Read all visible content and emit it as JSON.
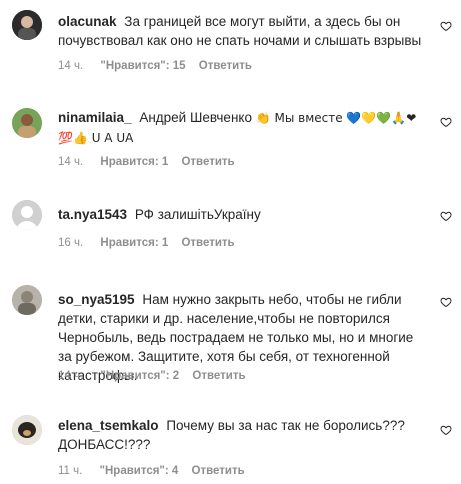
{
  "comments": [
    {
      "username": "olacunak",
      "text": "За границей все могут выйти, а здесь бы он почувствовал как оно не спать ночами и слышать взрывы",
      "time": "14 ч.",
      "likes": "\"Нравится\": 15",
      "reply": "Ответить"
    },
    {
      "username": "ninamilaia_",
      "text": "Андрей Шевченко",
      "emoji_text_1": "👏 Мы вместе 💙💛💚🙏❤",
      "emoji_text_2": "💯👍 U A UA",
      "time": "14 ч.",
      "likes": "Нравится: 1",
      "reply": "Ответить"
    },
    {
      "username": "ta.nya1543",
      "text": "РФ залишітьУкраїну",
      "time": "16 ч.",
      "likes": "Нравится: 1",
      "reply": "Ответить"
    },
    {
      "username": "so_nya5195",
      "text": "Нам нужно закрыть небо, чтобы не гибли детки, старики и др. население,чтобы не повторился Чернобыль, ведь пострадаем не только мы, но и многие за рубежом. Защитите, хотя бы себя, от техногенной катастрофы.",
      "time": "14 ч.",
      "likes": "\"Нравится\": 2",
      "reply": "Ответить"
    },
    {
      "username": "elena_tsemkalo",
      "text": "Почему вы за нас так не боролись??? ДОНБАСС!???",
      "time": "11 ч.",
      "likes": "\"Нравится\": 4",
      "reply": "Ответить"
    }
  ]
}
